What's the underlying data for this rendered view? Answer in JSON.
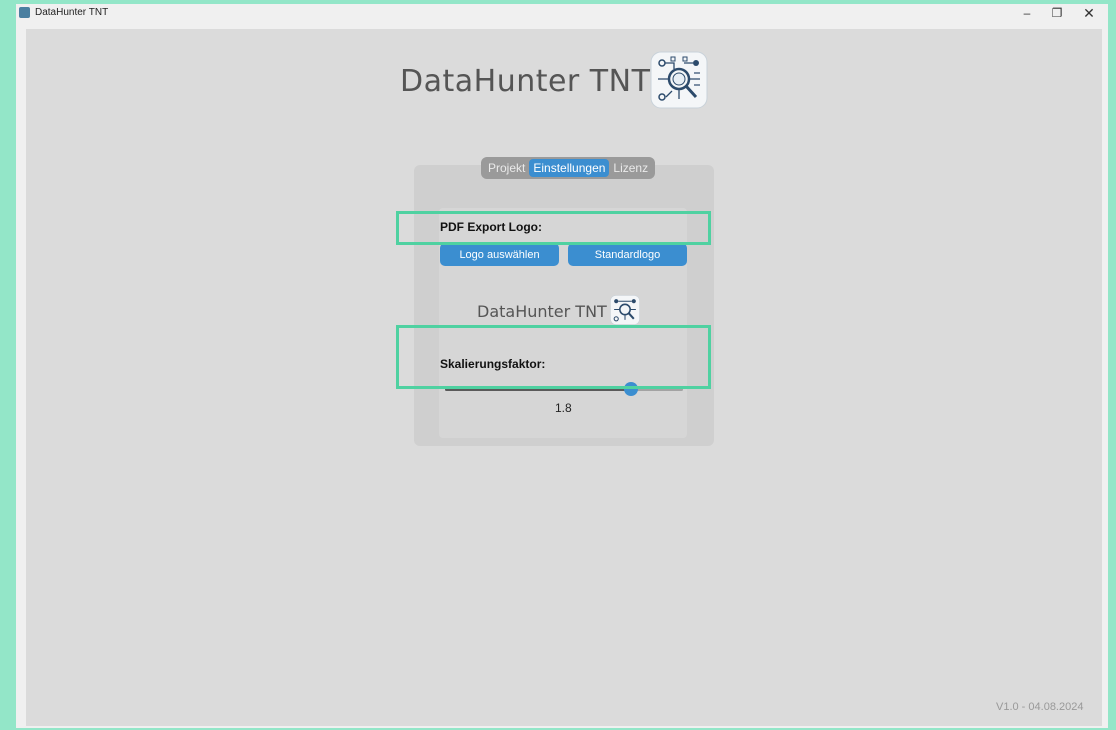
{
  "window": {
    "title": "DataHunter TNT",
    "controls": {
      "minimize": "–",
      "maximize": "❐",
      "close": "✕"
    }
  },
  "app": {
    "title": "DataHunter TNT",
    "logo_icon": "tnt-circuit-magnifier-icon"
  },
  "tabs": [
    {
      "label": "Projekt",
      "active": false
    },
    {
      "label": "Einstellungen",
      "active": true
    },
    {
      "label": "Lizenz",
      "active": false
    }
  ],
  "settings": {
    "pdf_logo_label": "PDF Export Logo:",
    "choose_logo_button": "Logo auswählen",
    "default_logo_button": "Standardlogo",
    "preview_title": "DataHunter TNT",
    "scale_label": "Skalierungsfaktor:",
    "scale_value": "1.8",
    "scale_fraction": 0.8
  },
  "footer": {
    "version": "V1.0 - 04.08.2024"
  },
  "colors": {
    "accent": "#3b8ed0",
    "highlight": "#4fd1a1"
  }
}
